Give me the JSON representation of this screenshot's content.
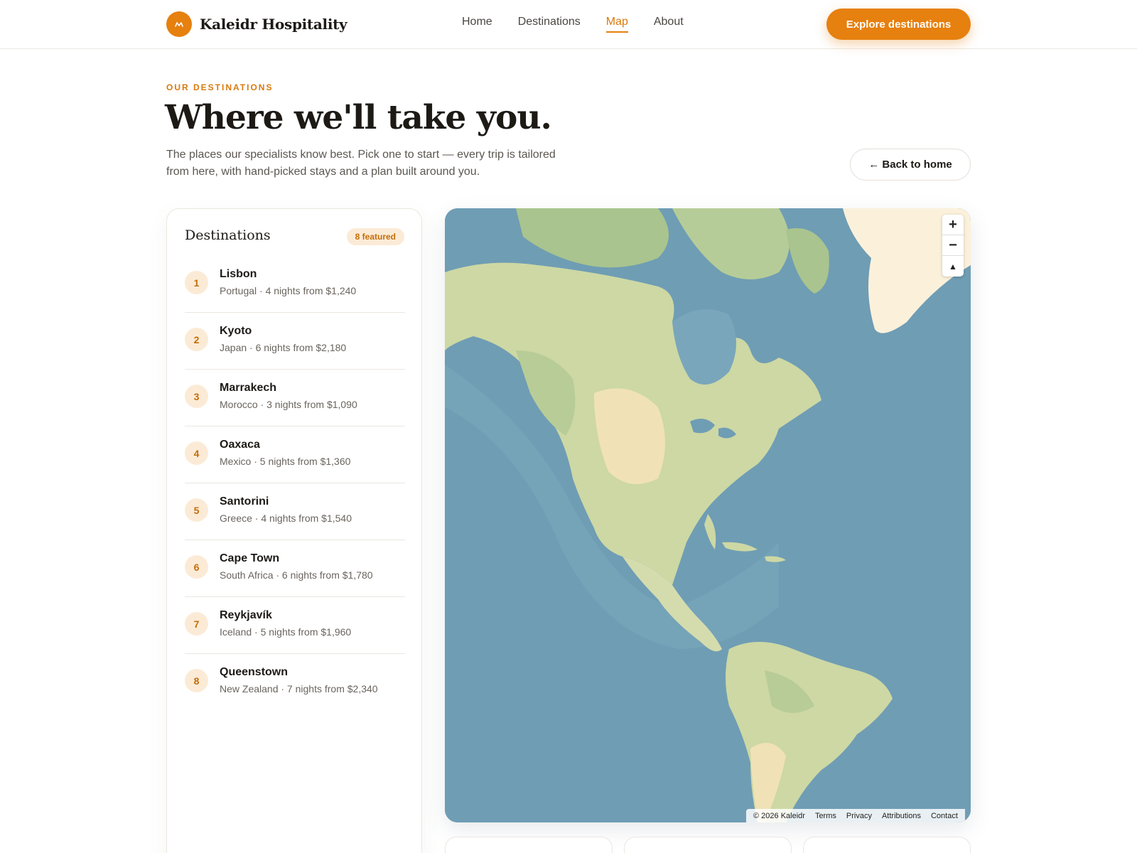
{
  "brand": {
    "name": "Kaleidr Hospitality",
    "logo_letter": "ᴹ"
  },
  "nav": {
    "items": [
      {
        "label": "Home",
        "active": false
      },
      {
        "label": "Destinations",
        "active": false
      },
      {
        "label": "Map",
        "active": true
      },
      {
        "label": "About",
        "active": false
      }
    ],
    "cta_label": "Explore destinations"
  },
  "hero": {
    "eyebrow": "OUR DESTINATIONS",
    "title": "Where we'll take you.",
    "subtitle": "The places our specialists know best. Pick one to start — every trip is tailored from here, with hand-picked stays and a plan built around you.",
    "back_label": "← Back to home"
  },
  "panel": {
    "title": "Destinations",
    "badge": "8 featured",
    "items": [
      {
        "num": "1",
        "city": "Lisbon",
        "meta": "Portugal · 4 nights from $1,240"
      },
      {
        "num": "2",
        "city": "Kyoto",
        "meta": "Japan · 6 nights from $2,180"
      },
      {
        "num": "3",
        "city": "Marrakech",
        "meta": "Morocco · 3 nights from $1,090"
      },
      {
        "num": "4",
        "city": "Oaxaca",
        "meta": "Mexico · 5 nights from $1,360"
      },
      {
        "num": "5",
        "city": "Santorini",
        "meta": "Greece · 4 nights from $1,540"
      },
      {
        "num": "6",
        "city": "Cape Town",
        "meta": "South Africa · 6 nights from $1,780"
      },
      {
        "num": "7",
        "city": "Reykjavík",
        "meta": "Iceland · 5 nights from $1,960"
      },
      {
        "num": "8",
        "city": "Queenstown",
        "meta": "New Zealand · 7 nights from $2,340"
      }
    ]
  },
  "map": {
    "zoom_in": "+",
    "zoom_out": "−",
    "compass": "▲",
    "attribution": [
      "© 2026 Kaleidr",
      "Terms",
      "Privacy",
      "Attributions",
      "Contact"
    ]
  },
  "colors": {
    "accent": "#e6800f",
    "water": "#6f9db4",
    "land": "#cdd8a4"
  }
}
